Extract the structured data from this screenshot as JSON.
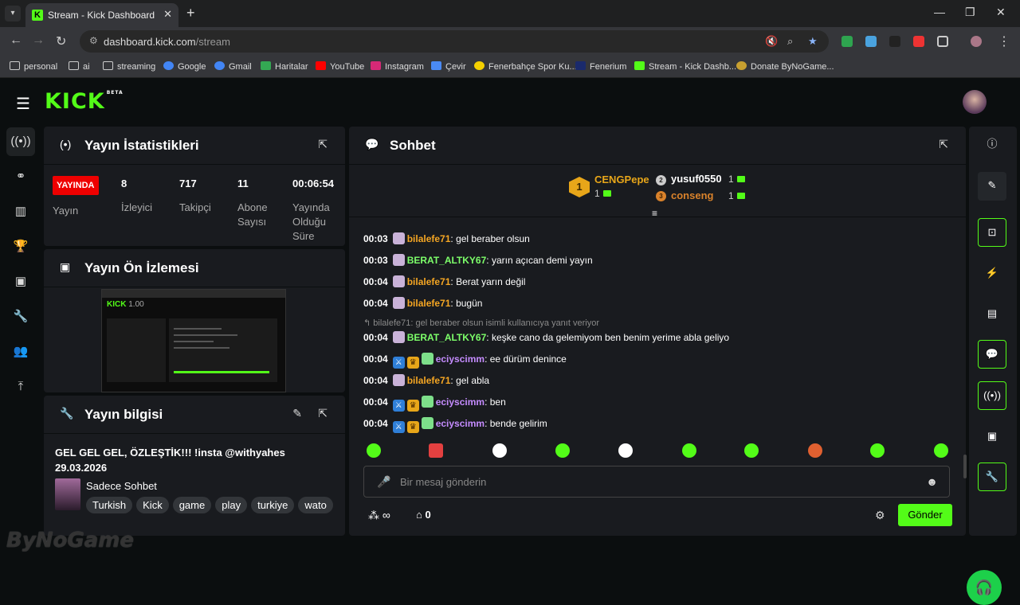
{
  "browser": {
    "tab_title": "Stream - Kick Dashboard",
    "url_host": "dashboard.kick.com",
    "url_path": "/stream",
    "bookmarks": [
      "personal",
      "ai",
      "streaming",
      "Google",
      "Gmail",
      "Haritalar",
      "YouTube",
      "Instagram",
      "Çevir",
      "Fenerbahçe Spor Ku...",
      "Fenerium",
      "Stream - Kick Dashb...",
      "Donate ByNoGame..."
    ]
  },
  "app": {
    "logo": "KICK",
    "logo_tag": "BETA"
  },
  "stats": {
    "title": "Yayın İstatistikleri",
    "live_badge": "YAYINDA",
    "live_label": "Yayın",
    "viewers": "8",
    "viewers_label": "İzleyici",
    "followers": "717",
    "followers_label": "Takipçi",
    "subs": "11",
    "subs_label": "Abone Sayısı",
    "uptime": "00:06:54",
    "uptime_label": "Yayında Olduğu Süre"
  },
  "preview": {
    "title": "Yayın Ön İzlemesi",
    "overlay_text": "1.00"
  },
  "info": {
    "title": "Yayın bilgisi",
    "stream_title": "GEL GEL GEL, ÖZLEŞTİK!!! !insta @withyahes 29.03.2026",
    "category": "Sadece Sohbet",
    "tags": [
      "Turkish",
      "Kick",
      "game",
      "play",
      "turkiye",
      "wato"
    ]
  },
  "chat": {
    "title": "Sohbet",
    "gifters": [
      {
        "name": "CENGPepe",
        "count": "1",
        "rank": "1"
      },
      {
        "name": "yusuf0550",
        "count": "1",
        "rank": "2"
      },
      {
        "name": "conseng",
        "count": "1",
        "rank": "3"
      }
    ],
    "messages": [
      {
        "ts": "00:03",
        "user": "bilalefe71",
        "text": ": gel beraber olsun",
        "color": "#f5a623"
      },
      {
        "ts": "00:03",
        "user": "BERAT_ALTKY67",
        "text": ": yarın açıcan demi yayın",
        "color": "#7dff6a"
      },
      {
        "ts": "00:04",
        "user": "bilalefe71",
        "text": ": Berat yarın değil",
        "color": "#f5a623"
      },
      {
        "ts": "00:04",
        "user": "bilalefe71",
        "text": ": bugün",
        "color": "#f5a623"
      },
      {
        "ts": "00:04",
        "user": "BERAT_ALTKY67",
        "text": ": keşke cano da gelemiyom ben benim yerime abla geliyo",
        "color": "#7dff6a"
      },
      {
        "ts": "00:04",
        "user": "eciyscimm",
        "text": ": ee dürüm denince",
        "color": "#c58cff"
      },
      {
        "ts": "00:04",
        "user": "bilalefe71",
        "text": ": gel abla",
        "color": "#f5a623"
      },
      {
        "ts": "00:04",
        "user": "eciyscimm",
        "text": ": ben",
        "color": "#c58cff"
      },
      {
        "ts": "00:04",
        "user": "eciyscimm",
        "text": ": bende gelirim",
        "color": "#c58cff"
      }
    ],
    "reply_context": "bilalefe71: gel beraber olsun isimli kullanıcıya yanıt veriyor",
    "input_placeholder": "Bir mesaj gönderin",
    "points": "∞",
    "store_count": "0",
    "send_label": "Gönder"
  },
  "watermark": "ByNoGame",
  "colors": {
    "accent": "#53fc18",
    "live": "#e00000",
    "panel": "#191b1f"
  }
}
